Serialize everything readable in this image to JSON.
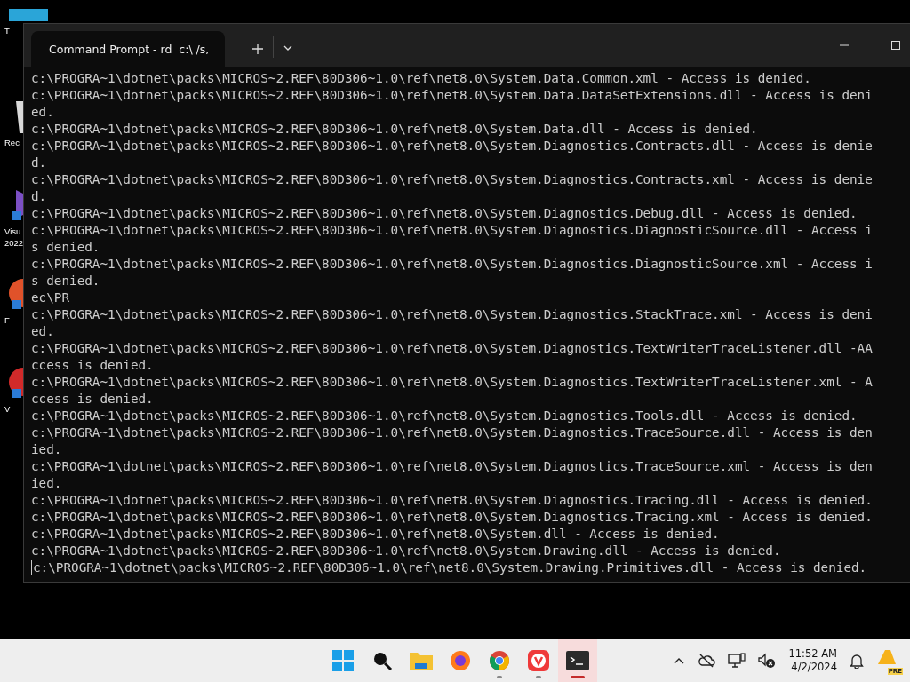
{
  "desktop_icons": [
    {
      "kind": "tile",
      "lines": [
        "T"
      ]
    },
    {
      "kind": "recycle",
      "lines": [
        "Rec"
      ]
    },
    {
      "kind": "studio",
      "lines": [
        "Visu",
        "2022"
      ]
    },
    {
      "kind": "orange",
      "lines": [
        "F"
      ]
    },
    {
      "kind": "red",
      "lines": [
        "V"
      ]
    }
  ],
  "window": {
    "tab": {
      "title": "Command Prompt - rd  c:\\ /s,",
      "selected": true
    },
    "console_lines": [
      "c:\\PROGRA~1\\dotnet\\packs\\MICROS~2.REF\\80D306~1.0\\ref\\net8.0\\System.Data.Common.xml - Access is denied.",
      "c:\\PROGRA~1\\dotnet\\packs\\MICROS~2.REF\\80D306~1.0\\ref\\net8.0\\System.Data.DataSetExtensions.dll - Access is deni",
      "ed.",
      "c:\\PROGRA~1\\dotnet\\packs\\MICROS~2.REF\\80D306~1.0\\ref\\net8.0\\System.Data.dll - Access is denied.",
      "c:\\PROGRA~1\\dotnet\\packs\\MICROS~2.REF\\80D306~1.0\\ref\\net8.0\\System.Diagnostics.Contracts.dll - Access is denie",
      "d.",
      "c:\\PROGRA~1\\dotnet\\packs\\MICROS~2.REF\\80D306~1.0\\ref\\net8.0\\System.Diagnostics.Contracts.xml - Access is denie",
      "d.",
      "c:\\PROGRA~1\\dotnet\\packs\\MICROS~2.REF\\80D306~1.0\\ref\\net8.0\\System.Diagnostics.Debug.dll - Access is denied.",
      "c:\\PROGRA~1\\dotnet\\packs\\MICROS~2.REF\\80D306~1.0\\ref\\net8.0\\System.Diagnostics.DiagnosticSource.dll - Access i",
      "s denied.",
      "c:\\PROGRA~1\\dotnet\\packs\\MICROS~2.REF\\80D306~1.0\\ref\\net8.0\\System.Diagnostics.DiagnosticSource.xml - Access i",
      "s denied.",
      "ec\\PR",
      "c:\\PROGRA~1\\dotnet\\packs\\MICROS~2.REF\\80D306~1.0\\ref\\net8.0\\System.Diagnostics.StackTrace.xml - Access is deni",
      "ed.",
      "c:\\PROGRA~1\\dotnet\\packs\\MICROS~2.REF\\80D306~1.0\\ref\\net8.0\\System.Diagnostics.TextWriterTraceListener.dll -AA",
      "ccess is denied.",
      "c:\\PROGRA~1\\dotnet\\packs\\MICROS~2.REF\\80D306~1.0\\ref\\net8.0\\System.Diagnostics.TextWriterTraceListener.xml - A",
      "ccess is denied.",
      "c:\\PROGRA~1\\dotnet\\packs\\MICROS~2.REF\\80D306~1.0\\ref\\net8.0\\System.Diagnostics.Tools.dll - Access is denied.",
      "c:\\PROGRA~1\\dotnet\\packs\\MICROS~2.REF\\80D306~1.0\\ref\\net8.0\\System.Diagnostics.TraceSource.dll - Access is den",
      "ied.",
      "c:\\PROGRA~1\\dotnet\\packs\\MICROS~2.REF\\80D306~1.0\\ref\\net8.0\\System.Diagnostics.TraceSource.xml - Access is den",
      "ied.",
      "c:\\PROGRA~1\\dotnet\\packs\\MICROS~2.REF\\80D306~1.0\\ref\\net8.0\\System.Diagnostics.Tracing.dll - Access is denied.",
      "c:\\PROGRA~1\\dotnet\\packs\\MICROS~2.REF\\80D306~1.0\\ref\\net8.0\\System.Diagnostics.Tracing.xml - Access is denied.",
      "c:\\PROGRA~1\\dotnet\\packs\\MICROS~2.REF\\80D306~1.0\\ref\\net8.0\\System.dll - Access is denied.",
      "c:\\PROGRA~1\\dotnet\\packs\\MICROS~2.REF\\80D306~1.0\\ref\\net8.0\\System.Drawing.dll - Access is denied.",
      "c:\\PROGRA~1\\dotnet\\packs\\MICROS~2.REF\\80D306~1.0\\ref\\net8.0\\System.Drawing.Primitives.dll - Access is denied."
    ]
  },
  "taskbar": {
    "apps": [
      {
        "kind": "start",
        "running": false,
        "selected": false
      },
      {
        "kind": "search",
        "running": false,
        "selected": false
      },
      {
        "kind": "explorer",
        "running": false,
        "selected": false
      },
      {
        "kind": "firefox",
        "running": false,
        "selected": false
      },
      {
        "kind": "chrome",
        "running": true,
        "selected": false
      },
      {
        "kind": "vivaldi",
        "running": true,
        "selected": false
      },
      {
        "kind": "terminal",
        "running": true,
        "selected": true
      }
    ],
    "time": "11:52 AM",
    "date": "4/2/2024",
    "badge": "PRE"
  }
}
